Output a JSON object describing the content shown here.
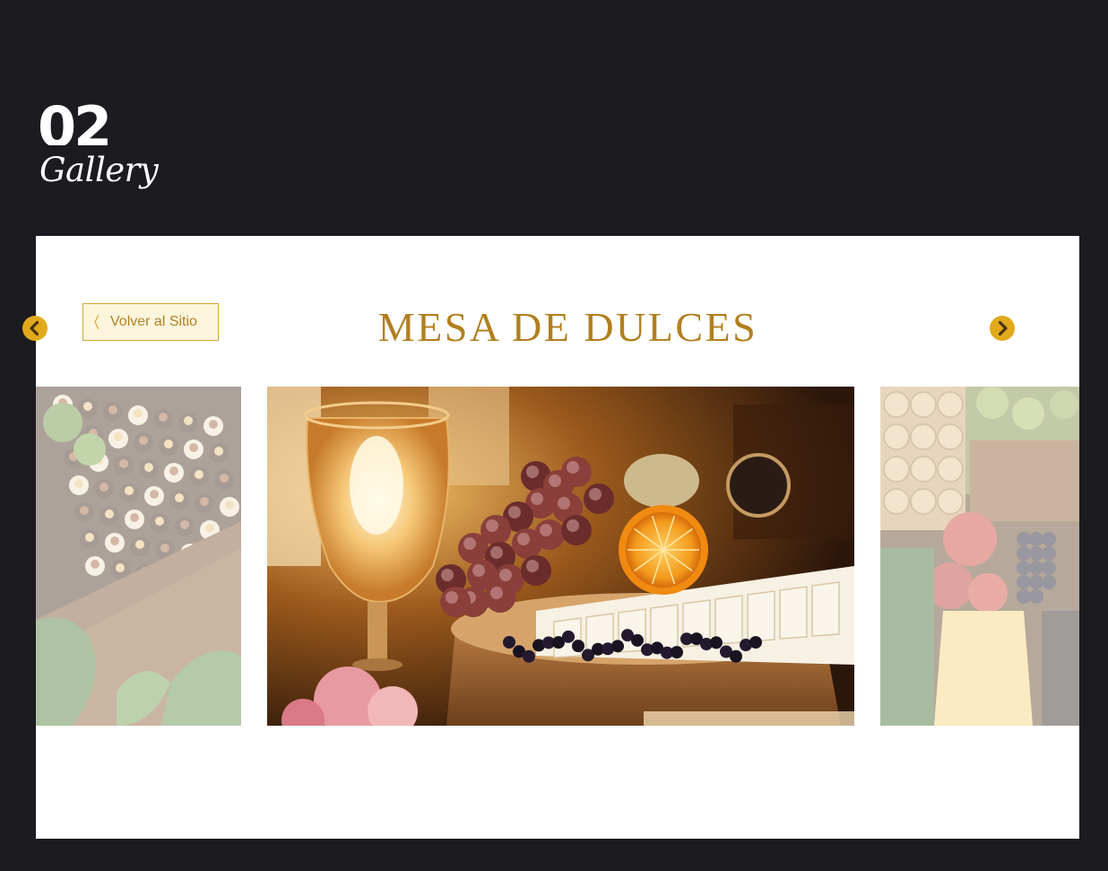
{
  "header": {
    "section_number": "02",
    "section_label": "Gallery"
  },
  "gallery": {
    "back_label": "Volver al Sitio",
    "title": "MESA DE DULCES",
    "slides": [
      {
        "name": "chocolate-truffle-tray",
        "state": "inactive"
      },
      {
        "name": "cheese-fruit-candle-table",
        "state": "active"
      },
      {
        "name": "fruit-nuts-platter",
        "state": "inactive"
      }
    ],
    "prev_icon": "chevron-left-icon",
    "next_icon": "chevron-right-icon"
  },
  "colors": {
    "background": "#1c1b20",
    "card": "#ffffff",
    "accent_gold": "#b27f1f",
    "button_border": "#d4a737",
    "button_fill": "#fdf5dc",
    "arrow_fill": "#e1a91c"
  }
}
